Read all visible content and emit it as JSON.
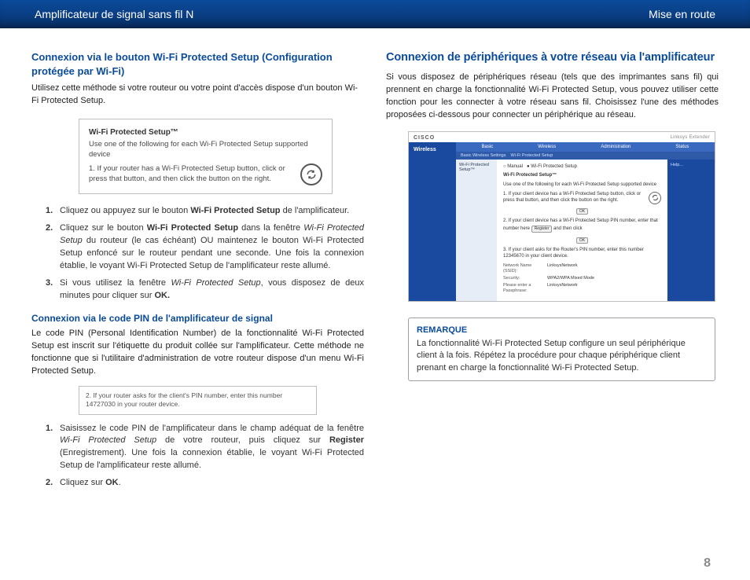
{
  "header": {
    "left": "Amplificateur de signal sans fil N",
    "right": "Mise en route"
  },
  "left_col": {
    "h3": "Connexion via le bouton Wi-Fi Protected Setup (Configuration protégée par Wi-Fi)",
    "intro": "Utilisez cette méthode si votre routeur ou votre point d'accès dispose d'un bouton Wi-Fi Protected Setup.",
    "fig1": {
      "title": "Wi-Fi Protected Setup™",
      "line": "Use one of the following for each Wi-Fi Protected Setup supported device",
      "step": "1. If your router has a Wi-Fi Protected Setup button, click or press that button, and then click the button on the right."
    },
    "steps_a": {
      "s1_pre": "Cliquez ou appuyez sur le bouton ",
      "s1_b": "Wi-Fi Protected Setup",
      "s1_post": " de l'amplificateur.",
      "s2_pre": "Cliquez sur le bouton ",
      "s2_b": "Wi-Fi Protected Setup",
      "s2_mid": " dans la fenêtre ",
      "s2_i": "Wi-Fi Protected Setup",
      "s2_post": " du routeur (le cas échéant) OU maintenez le bouton Wi-Fi Protected Setup enfoncé sur le routeur pendant une seconde. Une fois la connexion établie, le voyant Wi-Fi Protected Setup de l'amplificateur reste allumé.",
      "s3_pre": "Si vous utilisez la fenêtre ",
      "s3_i": "Wi-Fi Protected Setup",
      "s3_mid": ", vous disposez de deux minutes pour cliquer sur ",
      "s3_b": "OK."
    },
    "sub2": "Connexion via le code PIN de l'amplificateur de signal",
    "pin_intro": "Le code PIN (Personal Identification Number) de la fonctionnalité Wi-Fi Protected Setup est inscrit sur l'étiquette du produit collée sur l'amplificateur. Cette méthode ne fonctionne que si l'utilitaire d'administration de votre routeur dispose d'un menu Wi-Fi Protected Setup.",
    "fig2": "2. If your router asks for the client's PIN number, enter this number 14727030 in your router device.",
    "steps_b": {
      "s1_pre": "Saisissez le code PIN de l'amplificateur dans le champ adéquat de la fenêtre ",
      "s1_i": "Wi-Fi Protected Setup",
      "s1_mid": " de votre routeur, puis cliquez sur ",
      "s1_b": "Register",
      "s1_post": " (Enregistrement). Une fois la connexion établie, le voyant Wi-Fi Protected Setup de l'amplificateur reste allumé.",
      "s2_pre": "Cliquez sur ",
      "s2_b": "OK",
      "s2_post": "."
    }
  },
  "right_col": {
    "h2": "Connexion de périphériques à votre réseau via l'amplificateur",
    "intro": "Si vous disposez de périphériques réseau (tels que des imprimantes sans fil) qui prennent en charge la fonctionnalité Wi-Fi Protected Setup, vous pouvez utiliser cette fonction pour les connecter à votre réseau sans fil. Choisissez l'une des méthodes proposées ci-dessous pour connecter un périphérique au réseau.",
    "router": {
      "brand": "CISCO",
      "brand_right": "Linksys Extender",
      "side": "Wireless",
      "tab1": "Basic",
      "tab2": "Wireless",
      "tab3": "Administration",
      "tab4": "Status",
      "subtab1": "Basic Wireless Settings",
      "subtab2": "Wi-Fi Protected Setup",
      "left_label": "Wi-Fi Protected Setup™",
      "mode_manual": "Manual",
      "mode_wps": "Wi-Fi Protected Setup",
      "content_title": "Wi-Fi Protected Setup™",
      "content_line": "Use one of the following for each Wi-Fi Protected Setup supported device",
      "c1": "1. If your client device has a Wi-Fi Protected Setup button, click or press that button, and then click the button on the right.",
      "c2_pre": "2. If your client device has a Wi-Fi Protected Setup PIN number, enter that number here ",
      "c2_btn": "Register",
      "c2_post": " and then click",
      "c3": "3. If your client asks for the Router's PIN number, enter this number 12345670 in your client device.",
      "ok": "OK",
      "f1l": "Network Name (SSID):",
      "f1v": "LinksysNetwork",
      "f2l": "Security:",
      "f2v": "WPA2/WPA Mixed Mode",
      "f3l": "Please enter a Passphrase:",
      "f3v": "LinksysNetwork",
      "help": "Help..."
    },
    "note": {
      "label": "REMARQUE",
      "text": "La fonctionnalité Wi-Fi Protected Setup configure un seul périphérique client à la fois. Répétez la procédure pour chaque périphérique client prenant en charge la fonctionnalité Wi-Fi Protected Setup."
    }
  },
  "page_number": "8"
}
